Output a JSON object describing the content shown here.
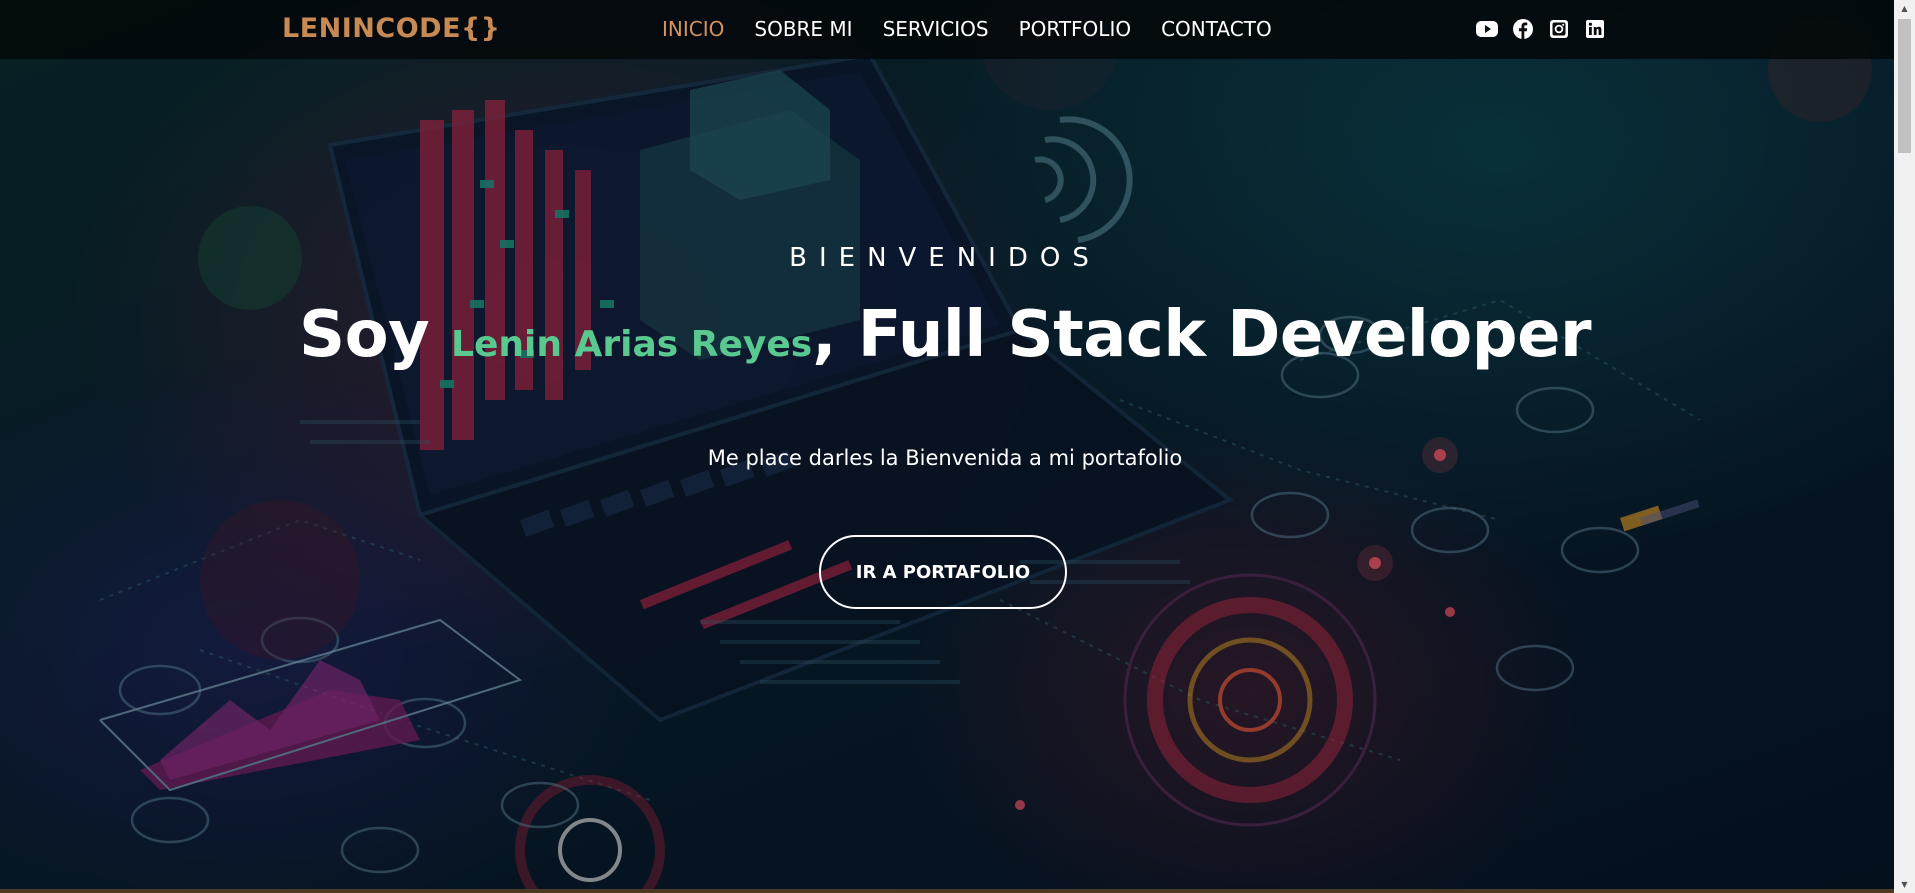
{
  "logo": "LENINCODE{}",
  "nav": {
    "items": [
      {
        "label": "INICIO",
        "active": true
      },
      {
        "label": "SOBRE MI",
        "active": false
      },
      {
        "label": "SERVICIOS",
        "active": false
      },
      {
        "label": "PORTFOLIO",
        "active": false
      },
      {
        "label": "CONTACTO",
        "active": false
      }
    ],
    "social_icons": [
      "youtube-icon",
      "facebook-icon",
      "instagram-icon",
      "linkedin-icon"
    ]
  },
  "hero": {
    "eyebrow": "BIENVENIDOS",
    "headline_prefix": "Soy ",
    "headline_name": "Lenin Arias Reyes",
    "headline_suffix": ", Full Stack Developer",
    "subtitle": "Me place darles la Bienvenida a mi portafolio",
    "cta_label": "IR A PORTAFOLIO"
  },
  "colors": {
    "logo": "#c88a55",
    "nav_active": "#d4935e",
    "name_accent": "#5ac98f",
    "navbar_bg": "#03080a",
    "text": "#ffffff"
  }
}
